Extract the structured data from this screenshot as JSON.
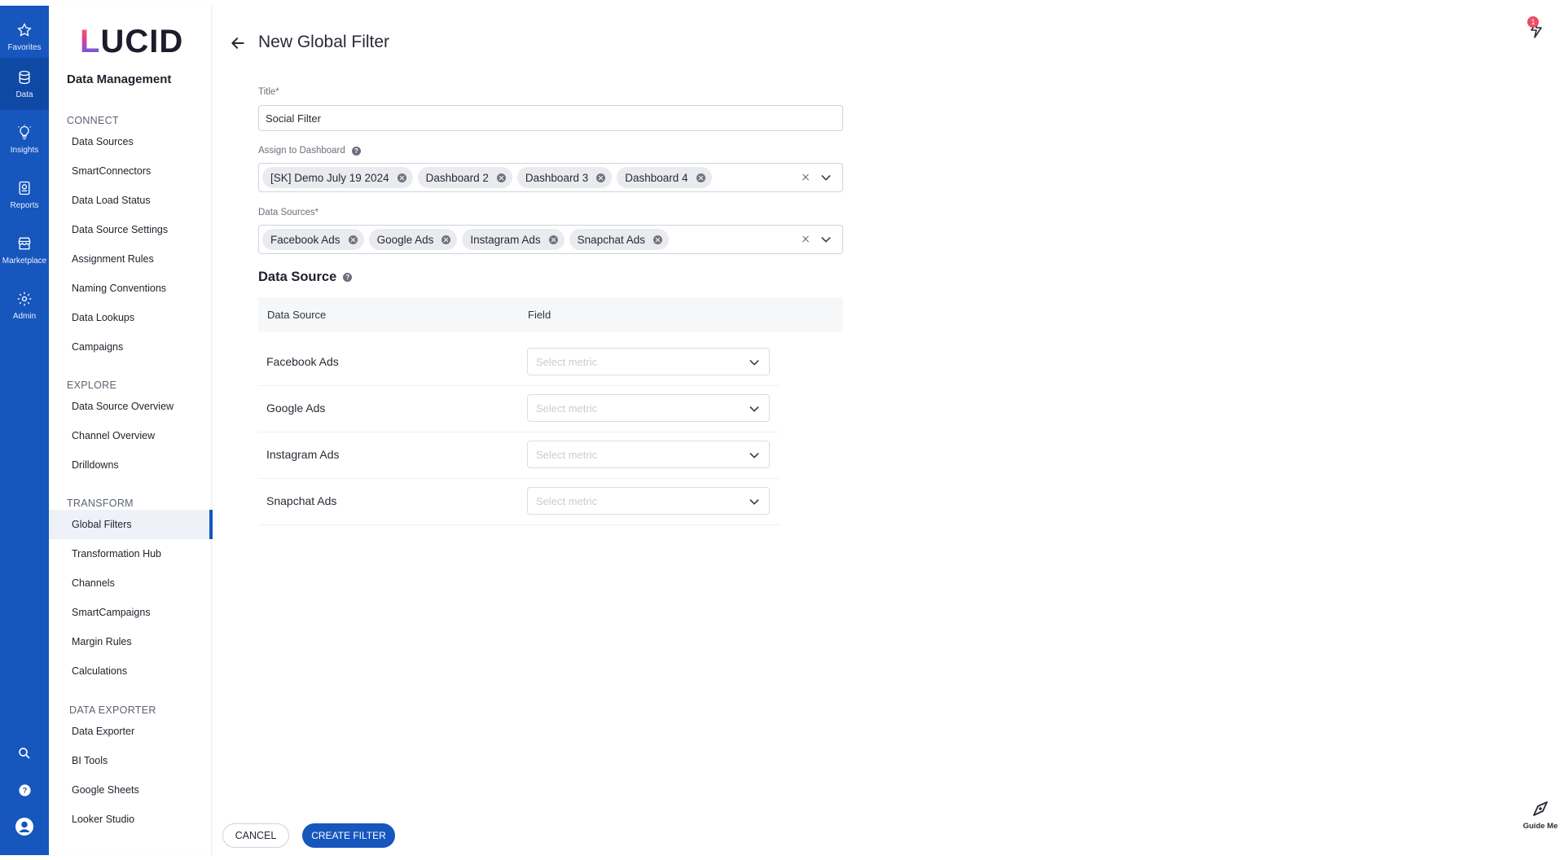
{
  "rail": {
    "items": [
      {
        "label": "Favorites",
        "icon": "star-icon"
      },
      {
        "label": "Data",
        "icon": "database-icon"
      },
      {
        "label": "Insights",
        "icon": "lightbulb-icon"
      },
      {
        "label": "Reports",
        "icon": "report-icon"
      },
      {
        "label": "Marketplace",
        "icon": "storefront-icon"
      },
      {
        "label": "Admin",
        "icon": "gear-icon"
      }
    ],
    "bottom": [
      "search-icon",
      "help-icon",
      "user-icon"
    ]
  },
  "nav": {
    "logo": {
      "first": "L",
      "rest": "UCID"
    },
    "title": "Data Management",
    "sections": [
      {
        "heading": "CONNECT",
        "items": [
          "Data Sources",
          "SmartConnectors",
          "Data Load Status",
          "Data Source Settings",
          "Assignment Rules",
          "Naming Conventions",
          "Data Lookups",
          "Campaigns"
        ]
      },
      {
        "heading": "EXPLORE",
        "items": [
          "Data Source Overview",
          "Channel Overview",
          "Drilldowns"
        ]
      },
      {
        "heading": "TRANSFORM",
        "items": [
          "Global Filters",
          "Transformation Hub",
          "Channels",
          "SmartCampaigns",
          "Margin Rules",
          "Calculations"
        ]
      },
      {
        "heading": "DATA EXPORTER",
        "items": [
          "Data Exporter",
          "BI Tools",
          "Google Sheets",
          "Looker Studio"
        ]
      }
    ],
    "active_item": "Global Filters"
  },
  "main": {
    "title": "New Global Filter",
    "title_field": {
      "label": "Title*",
      "value": "Social Filter"
    },
    "dashboards": {
      "label": "Assign to Dashboard",
      "chips": [
        "[SK] Demo July 19 2024",
        "Dashboard 2",
        "Dashboard 3",
        "Dashboard 4"
      ]
    },
    "data_sources": {
      "label": "Data Sources*",
      "chips": [
        "Facebook Ads",
        "Google Ads",
        "Instagram Ads",
        "Snapchat Ads"
      ]
    },
    "table": {
      "section_title": "Data Source",
      "col_source": "Data Source",
      "col_field": "Field",
      "rows": [
        {
          "source": "Facebook Ads",
          "placeholder": "Select metric"
        },
        {
          "source": "Google Ads",
          "placeholder": "Select metric"
        },
        {
          "source": "Instagram Ads",
          "placeholder": "Select metric"
        },
        {
          "source": "Snapchat Ads",
          "placeholder": "Select metric"
        }
      ]
    }
  },
  "footer": {
    "cancel": "CANCEL",
    "create": "CREATE FILTER"
  },
  "top_right": {
    "notification_count": "1"
  },
  "guide": {
    "label": "Guide Me"
  },
  "colors": {
    "primary": "#1656bd",
    "badge": "#ef4b65"
  }
}
